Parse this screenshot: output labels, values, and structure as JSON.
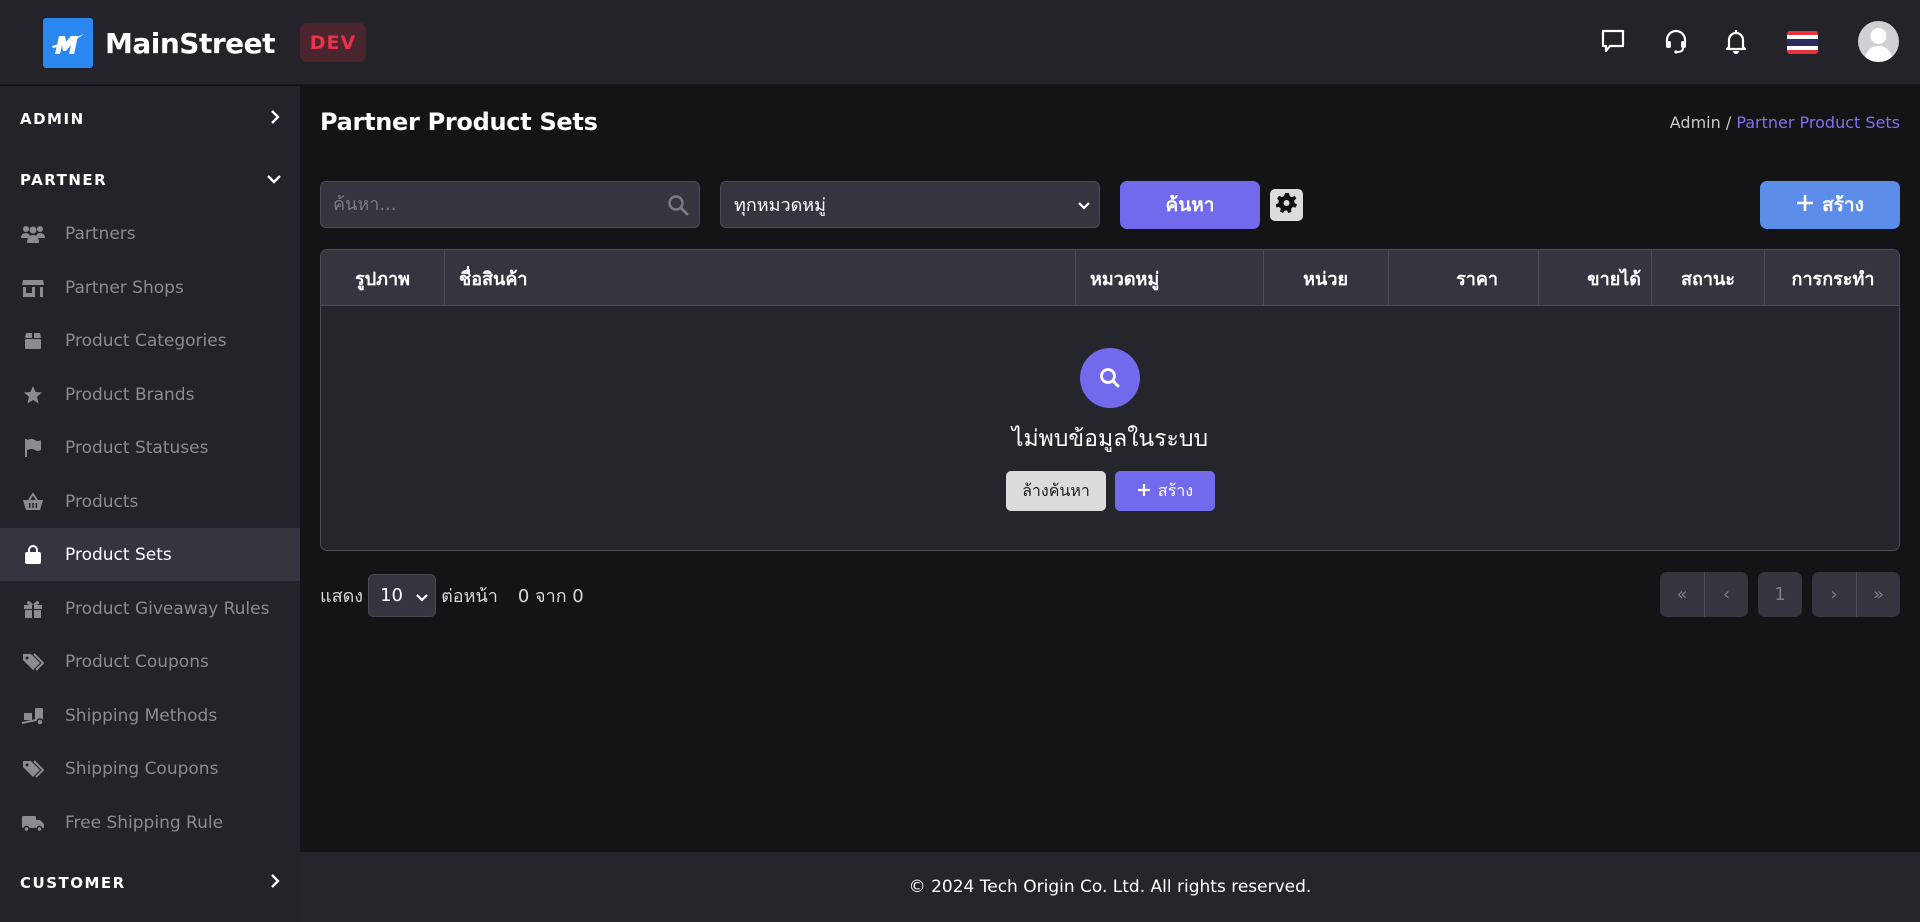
{
  "header": {
    "brand": "MainStreet",
    "env_badge": "DEV",
    "icons": [
      "chat-icon",
      "headset-icon",
      "bell-icon",
      "thai-flag-icon",
      "user-avatar"
    ]
  },
  "sidebar": {
    "sections": [
      {
        "label": "ADMIN",
        "expanded": false
      },
      {
        "label": "PARTNER",
        "expanded": true
      },
      {
        "label": "CUSTOMER",
        "expanded": false
      }
    ],
    "items": [
      {
        "label": "Partners",
        "icon": "users-icon",
        "active": false
      },
      {
        "label": "Partner Shops",
        "icon": "store-icon",
        "active": false
      },
      {
        "label": "Product Categories",
        "icon": "box-icon",
        "active": false
      },
      {
        "label": "Product Brands",
        "icon": "star-icon",
        "active": false
      },
      {
        "label": "Product Statuses",
        "icon": "flag-icon",
        "active": false
      },
      {
        "label": "Products",
        "icon": "basket-icon",
        "active": false
      },
      {
        "label": "Product Sets",
        "icon": "shopping-bag-icon",
        "active": true
      },
      {
        "label": "Product Giveaway Rules",
        "icon": "gift-icon",
        "active": false
      },
      {
        "label": "Product Coupons",
        "icon": "tags-icon",
        "active": false
      },
      {
        "label": "Shipping Methods",
        "icon": "dolly-icon",
        "active": false
      },
      {
        "label": "Shipping Coupons",
        "icon": "tags-icon",
        "active": false
      },
      {
        "label": "Free Shipping Rule",
        "icon": "truck-icon",
        "active": false
      }
    ]
  },
  "main": {
    "title": "Partner Product Sets",
    "breadcrumb": {
      "root": "Admin",
      "separator": " / ",
      "current": "Partner Product Sets"
    },
    "search": {
      "placeholder": "ค้นหา...",
      "value": ""
    },
    "category_select": {
      "selected": "ทุกหมวดหมู่"
    },
    "search_button": "ค้นหา",
    "create_button": "สร้าง",
    "table": {
      "columns": [
        "รูปภาพ",
        "ชื่อสินค้า",
        "หมวดหมู่",
        "หน่วย",
        "ราคา",
        "ขายได้",
        "สถานะ",
        "การกระทำ"
      ],
      "rows": [],
      "empty_message": "ไม่พบข้อมูลในระบบ",
      "clear_button": "ล้างค้นหา",
      "create_button": "สร้าง"
    },
    "pagination": {
      "show_label": "แสดง",
      "per_page": "10",
      "per_page_suffix": "ต่อหน้า",
      "summary": "0 จาก 0",
      "current_page": "1",
      "first": "«",
      "prev": "‹",
      "next": "›",
      "last": "»"
    }
  },
  "footer": {
    "text": "© 2024 Tech Origin Co. Ltd. All rights reserved."
  },
  "colors": {
    "accent": "#7269ec",
    "create_blue": "#5b8de8",
    "dev_badge": "#e8334a",
    "brand_blue": "#2b87f0"
  }
}
